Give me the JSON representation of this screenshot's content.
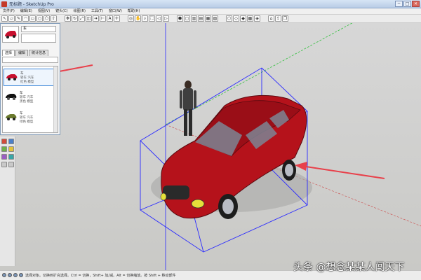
{
  "window": {
    "title": "无标题 - SketchUp Pro",
    "buttons": [
      "─",
      "□",
      "✕"
    ]
  },
  "menu": {
    "items": [
      "文件(F)",
      "编辑(E)",
      "视图(V)",
      "镜头(C)",
      "绘图(R)",
      "工具(T)",
      "窗口(W)",
      "帮助(H)"
    ]
  },
  "components_panel": {
    "name_value": "车",
    "tabs": [
      "选择",
      "编辑",
      "统计信息"
    ],
    "items": [
      {
        "title": "车",
        "subtitle": "轿车 汽车",
        "extra": "红色 模型",
        "selected": true,
        "color": "#c8102e"
      },
      {
        "title": "车",
        "subtitle": "轿车 汽车",
        "extra": "黑色 模型",
        "selected": false,
        "color": "#111111"
      },
      {
        "title": "车",
        "subtitle": "轿车 汽车",
        "extra": "绿色 模型",
        "selected": false,
        "color": "#6b7a2e"
      }
    ]
  },
  "status": {
    "text": "选择对象。切换到扩充选择。Ctrl = 切换，Shift+ 加/减。Alt = 切换缩放。按 Shift + 移动部件"
  },
  "watermark": "头条 @想念某某人闯天下",
  "colors": {
    "car_body": "#b5121b",
    "bounding_box": "#2a2aff",
    "annotation_arrow": "#e8404a",
    "axis_green": "#2fbf3a",
    "axis_blue": "#2a2aff"
  }
}
